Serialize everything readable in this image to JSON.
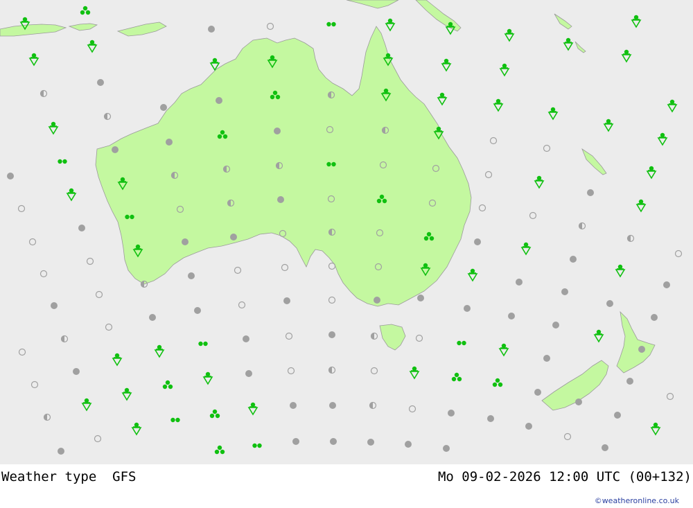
{
  "title": {
    "product": "Weather type",
    "model": "GFS",
    "valid_time": "Mo 09-02-2026 12:00 UTC (00+132)"
  },
  "credit": "©weatheronline.co.uk",
  "colors": {
    "ocean": "#ececec",
    "land": "#c4f8a0",
    "coast": "#9a9a9a",
    "precip": "#10c010",
    "cloud": "#a0a0a0"
  },
  "legend_symbols": {
    "shower": "green dot over open triangle",
    "rain": "two green dots",
    "thunder_rain": "three green dots",
    "overcast": "grey filled circle",
    "partly_cloudy": "half-filled circle",
    "clear": "open circle"
  }
}
